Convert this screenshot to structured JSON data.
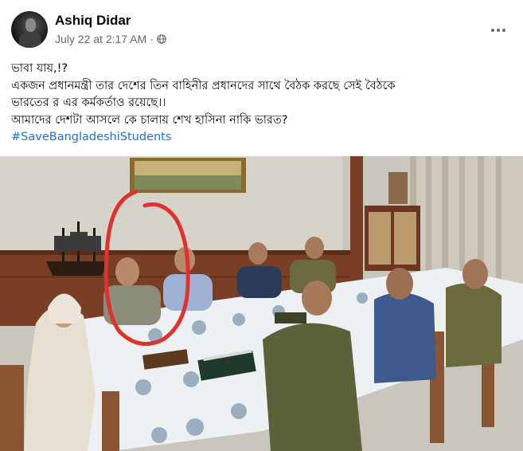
{
  "post": {
    "author": "Ashiq Didar",
    "timestamp": "July 22 at 2:17 AM",
    "separator": "·",
    "privacy_icon": "globe-icon",
    "more_icon": "more-dots-icon",
    "lines": [
      "ভাবা যায়,!?",
      "একজন প্রধানমন্ত্রী তার দেশের তিন বাহিনীর প্রধানদের সাথে বৈঠক করছে সেই বৈঠকে",
      "ভারতের র এর কর্মকর্তাও রয়েছে।।",
      "আমাদের দেশটা আসলে কে চালায় শেখ হাসিনা নাকি ভারত?"
    ],
    "hashtag": "#SaveBangladeshiStudents"
  },
  "colors": {
    "hashtag": "#216fdb",
    "meta_text": "#65676b",
    "annotation_circle": "#e0322c"
  }
}
